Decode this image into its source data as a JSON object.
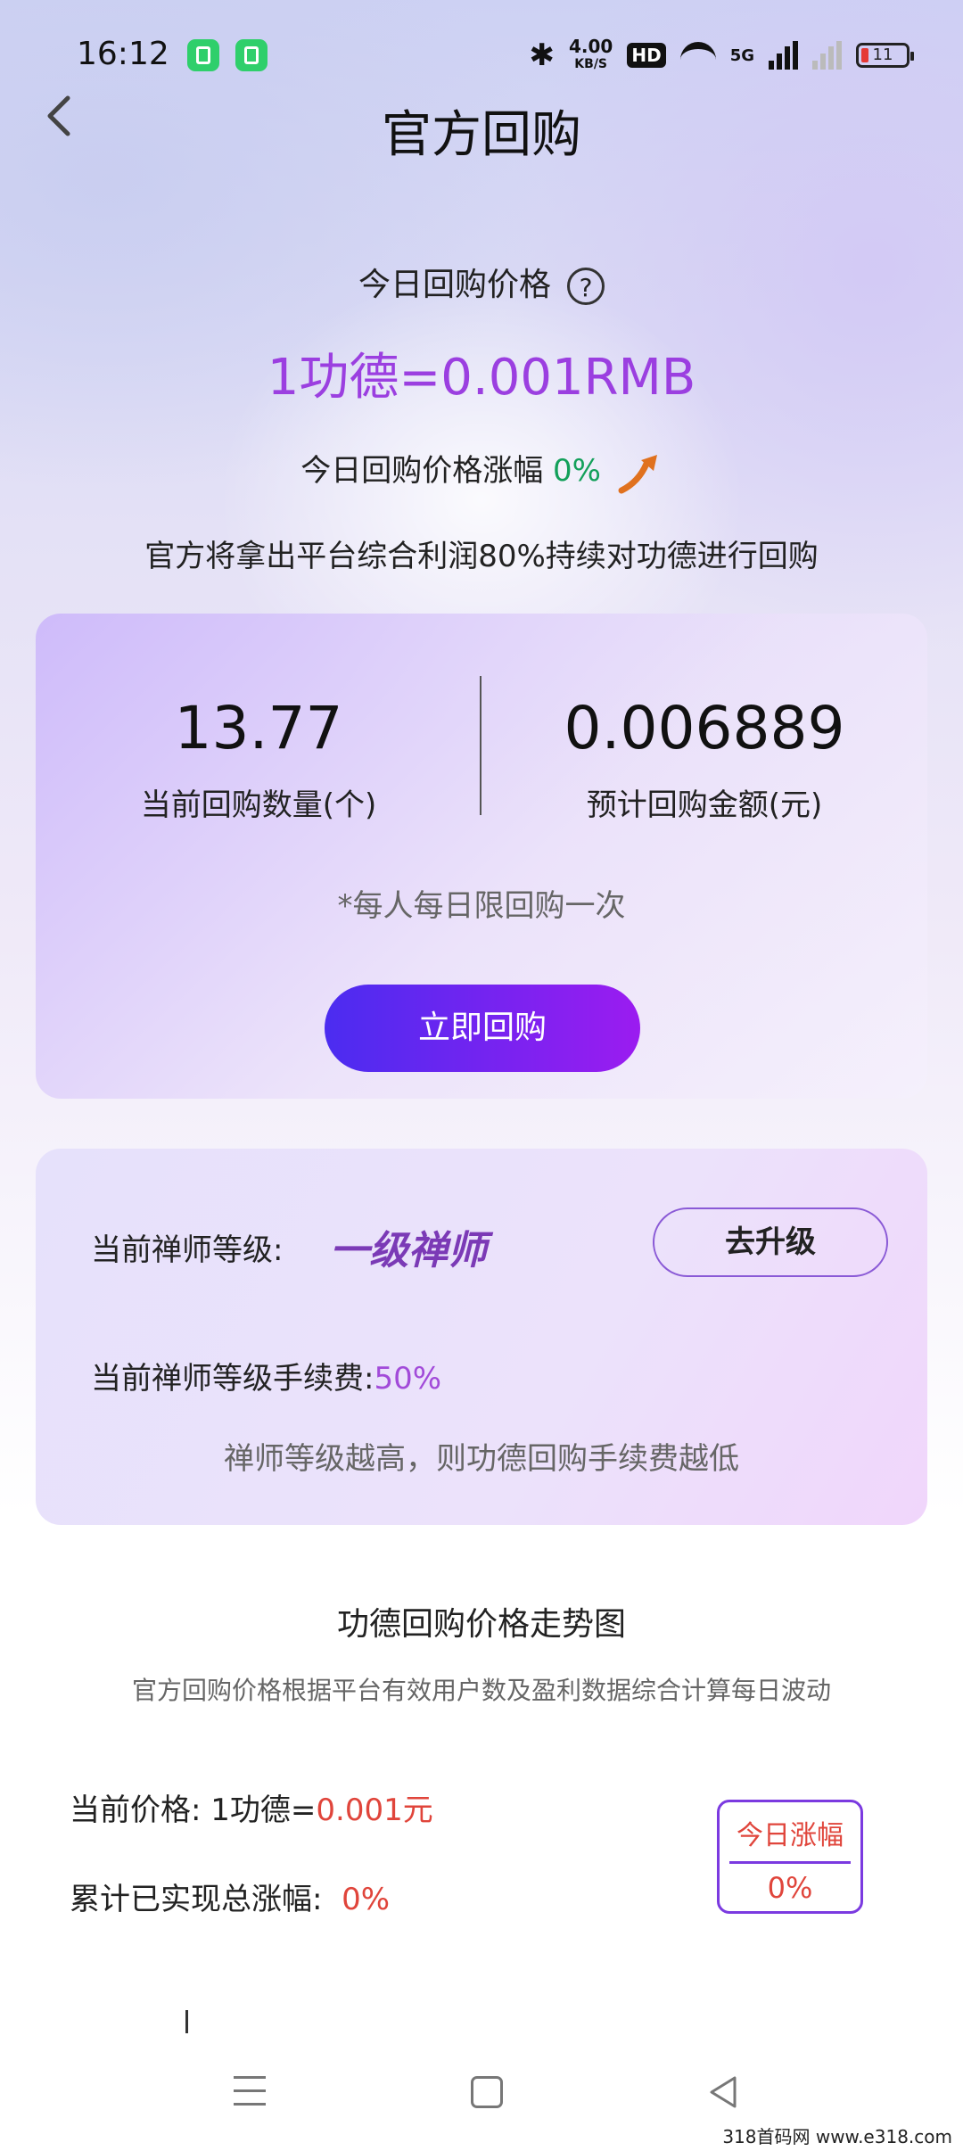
{
  "status_bar": {
    "time": "16:12",
    "speed_value": "4.00",
    "speed_unit": "KB/S",
    "hd_label": "HD",
    "network": "5G",
    "battery": "11"
  },
  "header": {
    "title": "官方回购"
  },
  "price": {
    "label": "今日回购价格",
    "help": "?",
    "rate": "1功德=0.001RMB",
    "change_label": "今日回购价格涨幅",
    "change_value": "0%",
    "description": "官方将拿出平台综合利润80%持续对功德进行回购"
  },
  "buyback_card": {
    "quantity": "13.77",
    "quantity_label": "当前回购数量(个)",
    "amount": "0.006889",
    "amount_label": "预计回购金额(元)",
    "limit_note": "*每人每日限回购一次",
    "buy_button": "立即回购"
  },
  "level_card": {
    "level_label": "当前禅师等级:",
    "level_value": "一级禅师",
    "upgrade_button": "去升级",
    "fee_label": "当前禅师等级手续费:",
    "fee_value": "50%",
    "fee_note": "禅师等级越高，则功德回购手续费越低"
  },
  "trend": {
    "title": "功德回购价格走势图",
    "subtitle": "官方回购价格根据平台有效用户数及盈利数据综合计算每日波动",
    "current_price_label": "当前价格:  1功德=",
    "current_price_value": "0.001元",
    "total_rise_label": "累计已实现总涨幅:",
    "total_rise_value": "0%",
    "today_rise_label": "今日涨幅",
    "today_rise_value": "0%"
  },
  "watermark": "318首码网  www.e318.com",
  "colors": {
    "accent_purple": "#9b3fe0",
    "rise_green": "#13a05a",
    "price_red": "#e0453b",
    "button_start": "#4b2cf0",
    "button_end": "#9b1cf0"
  }
}
